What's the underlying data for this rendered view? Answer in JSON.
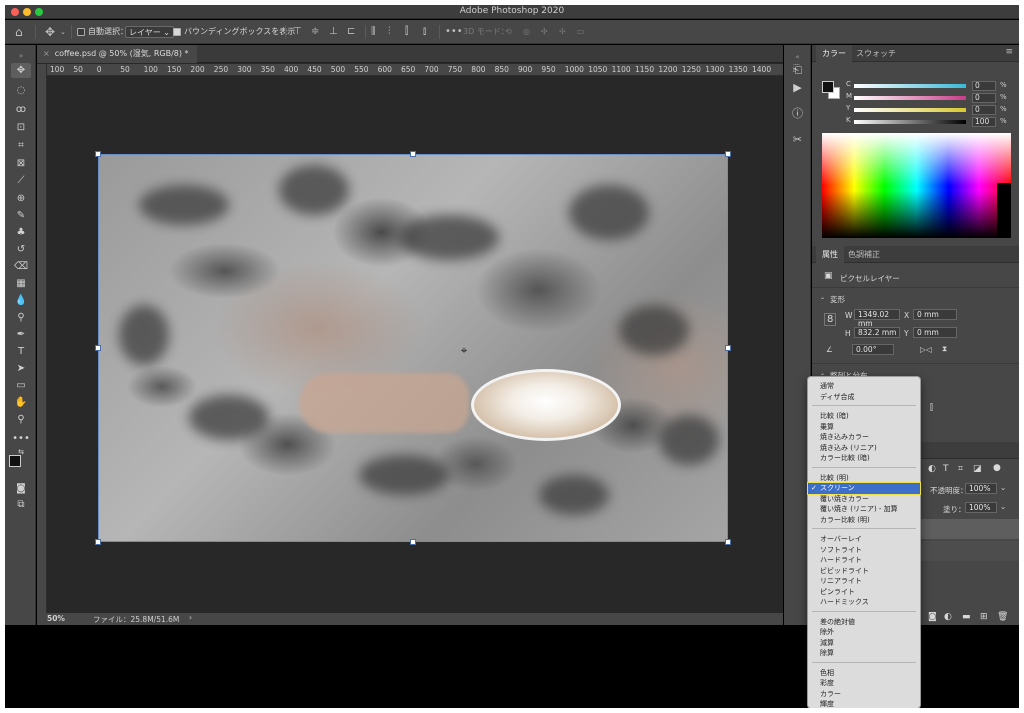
{
  "app": {
    "title": "Adobe Photoshop 2020"
  },
  "options_bar": {
    "auto_select_label": "自動選択：",
    "auto_select_value": "レイヤー",
    "bounding_box_label": "バウンディングボックスを表示",
    "mode_3d_label": "3D モード："
  },
  "document": {
    "tab_label": "coffee.psd @ 50% (湿気, RGB/8) *",
    "ruler_marks": [
      "100",
      "50",
      "0",
      "50",
      "100",
      "150",
      "200",
      "250",
      "300",
      "350",
      "400",
      "450",
      "500",
      "550",
      "600",
      "650",
      "700",
      "750",
      "800",
      "850",
      "900",
      "950",
      "1000",
      "1050",
      "1100",
      "1150",
      "1200",
      "1250",
      "1300",
      "1350",
      "1400"
    ],
    "zoom": "50%",
    "file_info": "ファイル：25.8M/51.6M",
    "status_arrow": "›"
  },
  "color_panel": {
    "tabs": [
      "カラー",
      "スウォッチ"
    ],
    "channels": [
      {
        "label": "C",
        "value": "0",
        "unit": "%",
        "color": "#38b8d8"
      },
      {
        "label": "M",
        "value": "0",
        "unit": "%",
        "color": "#c93c88"
      },
      {
        "label": "Y",
        "value": "0",
        "unit": "%",
        "color": "#d8c92f"
      },
      {
        "label": "K",
        "value": "100",
        "unit": "%",
        "color": "#cccccc"
      }
    ]
  },
  "properties_panel": {
    "tabs": [
      "属性",
      "色調補正"
    ],
    "layer_type": "ピクセルレイヤー",
    "transform_label": "変形",
    "w_label": "W",
    "w_value": "1349.02 mm",
    "h_label": "H",
    "h_value": "832.2 mm",
    "x_label": "X",
    "x_value": "0 mm",
    "y_label": "Y",
    "y_value": "0 mm",
    "angle_value": "0.00°",
    "align_label": "整列と分布"
  },
  "layers_panel": {
    "opacity_label": "不透明度：",
    "opacity_value": "100%",
    "fill_label": "塗り：",
    "fill_value": "100%"
  },
  "blend_menu": {
    "groups": [
      [
        "通常",
        "ディザ合成"
      ],
      [
        "比較 (暗)",
        "乗算",
        "焼き込みカラー",
        "焼き込み (リニア)",
        "カラー比較 (暗)"
      ],
      [
        "比較 (明)",
        "スクリーン",
        "覆い焼きカラー",
        "覆い焼き (リニア) - 加算",
        "カラー比較 (明)"
      ],
      [
        "オーバーレイ",
        "ソフトライト",
        "ハードライト",
        "ビビッドライト",
        "リニアライト",
        "ピンライト",
        "ハードミックス"
      ],
      [
        "差の絶対値",
        "除外",
        "減算",
        "除算"
      ],
      [
        "色相",
        "彩度",
        "カラー",
        "輝度"
      ]
    ],
    "selected": "スクリーン",
    "check": "✓"
  }
}
